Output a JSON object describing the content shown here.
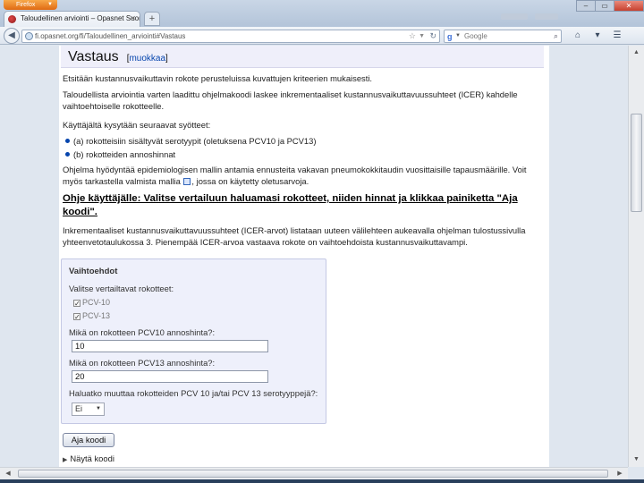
{
  "browser": {
    "menu_button": "Firefox",
    "tab_title": "Taloudellinen arviointi – Opasnet Suomi",
    "new_tab": "+",
    "url": "fi.opasnet.org/fi/Taloudellinen_arviointi#Vastaus",
    "search_placeholder": "Google"
  },
  "page": {
    "heading": "Vastaus",
    "edit_link": "muokkaa",
    "para1": "Etsitään kustannusvaikuttavin rokote perusteluissa kuvattujen kriteerien mukaisesti.",
    "para2": "Taloudellista arviointia varten laadittu ohjelmakoodi laskee inkrementaaliset kustannusvaikuttavuussuhteet (ICER) kahdelle vaihtoehtoiselle rokotteelle.",
    "para3": "Käyttäjältä kysytään seuraavat syötteet:",
    "bullets": [
      "(a) rokotteisiin sisältyvät serotyypit (oletuksena PCV10 ja PCV13)",
      "(b) rokotteiden annoshinnat"
    ],
    "para4a": "Ohjelma hyödyntää epidemiologisen mallin antamia ennusteita vakavan pneumokokkitaudin vuosittaisille tapausmäärille. Voit myös tarkastella valmista mallia",
    "para4b": ", jossa on käytetty oletusarvoja.",
    "instruction": "Ohje käyttäjälle: Valitse vertailuun haluamasi rokotteet, niiden hinnat ja klikkaa painiketta \"Aja koodi\".",
    "para5": "Inkrementaaliset kustannusvaikuttavuussuhteet (ICER-arvot) listataan uuteen välilehteen aukeavalla ohjelman tulostussivulla yhteenvetotaulukossa 3. Pienempää ICER-arvoa vastaava rokote on vaihtoehdoista kustannusvaikuttavampi.",
    "options": {
      "title": "Vaihtoehdot",
      "choose_label": "Valitse vertailtavat rokotteet:",
      "checkboxes": [
        {
          "label": "PCV-10",
          "checked": true
        },
        {
          "label": "PCV-13",
          "checked": true
        }
      ],
      "pcv10_label": "Mikä on rokotteen PCV10 annoshinta?:",
      "pcv10_value": "10",
      "pcv13_label": "Mikä on rokotteen PCV13 annoshinta?:",
      "pcv13_value": "20",
      "serotype_label": "Haluatko muuttaa rokotteiden PCV 10 ja/tai PCV 13 serotyyppejä?:",
      "serotype_value": "Ei"
    },
    "run_button": "Aja koodi",
    "show_code": "Näytä koodi"
  },
  "icons": [
    "firefox-logo-icon",
    "favicon-icon",
    "close-icon",
    "back-arrow-icon",
    "globe-icon",
    "bookmark-star-icon",
    "reload-icon",
    "google-icon",
    "search-icon",
    "home-icon",
    "downloads-icon",
    "menu-icon"
  ]
}
